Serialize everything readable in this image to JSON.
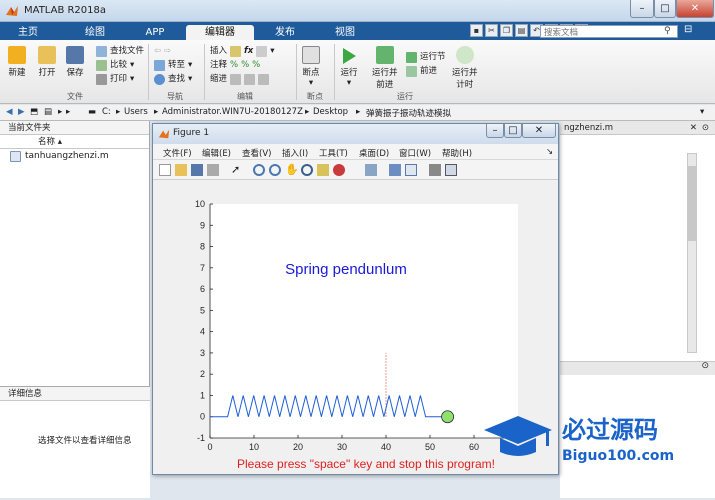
{
  "window": {
    "title": "MATLAB R2018a",
    "min": "–",
    "max": "□",
    "close": "✕"
  },
  "tabs": [
    "主页",
    "绘图",
    "APP",
    "编辑器",
    "发布",
    "视图"
  ],
  "search": {
    "placeholder": "搜索文档"
  },
  "ribbon": {
    "file": {
      "new": "新建",
      "open": "打开",
      "save": "保存",
      "find_files": "查找文件",
      "compare": "比较",
      "print": "打印",
      "group": "文件"
    },
    "navigate": {
      "goto": "转至",
      "find": "查找",
      "group": "导航"
    },
    "edit": {
      "insert": "插入",
      "comment": "注释",
      "indent": "缩进",
      "group": "编辑"
    },
    "breakpoints": {
      "label": "断点",
      "group": "断点"
    },
    "run": {
      "run": "运行",
      "run_advance": "运行并\n前进",
      "run_section": "运行节",
      "advance": "前进",
      "run_time": "运行并\n计时",
      "group": "运行"
    }
  },
  "address": {
    "crumbs": [
      "C:",
      "Users",
      "Administrator.WIN7U-20180127Z",
      "Desktop",
      "弹簧振子振动轨迹模拟"
    ]
  },
  "current_folder": {
    "title": "当前文件夹",
    "name_header": "名称",
    "files": [
      "tanhuangzhenzi.m"
    ]
  },
  "details": {
    "title": "详细信息",
    "message": "选择文件以查看详细信息"
  },
  "right_tab": {
    "label": "ngzhenzi.m"
  },
  "figure": {
    "title": "Figure 1",
    "menu": [
      "文件(F)",
      "编辑(E)",
      "查看(V)",
      "插入(I)",
      "工具(T)",
      "桌面(D)",
      "窗口(W)",
      "帮助(H)"
    ],
    "close": "✕"
  },
  "chart_data": {
    "type": "line",
    "title": "Spring pendunlum",
    "annotation": "Please press \"space\" key and stop this program!",
    "xlim": [
      0,
      70
    ],
    "ylim": [
      -1,
      10
    ],
    "xticks": [
      "0",
      "10",
      "20",
      "30",
      "40",
      "50",
      "60"
    ],
    "yticks": [
      "-1",
      "0",
      "1",
      "2",
      "3",
      "4",
      "5",
      "6",
      "7",
      "8",
      "9",
      "10"
    ],
    "spring": {
      "start_x": 4,
      "end_x": 49,
      "coils": 19,
      "y_low": 0,
      "y_high": 1,
      "lead_in": [
        0,
        4
      ],
      "lead_out": [
        49,
        54
      ]
    },
    "marker_line_x": 40,
    "marker_line_y": [
      0,
      3
    ],
    "mass": {
      "x": 54,
      "y": 0
    },
    "colors": {
      "spring": "#1f5fd6",
      "mass": "#90e070",
      "marker": "#e27a6a",
      "title": "#1a1ad9",
      "annotation": "#e02020"
    }
  },
  "watermark": {
    "text": "必过源码",
    "url": "Biguo100.com"
  }
}
